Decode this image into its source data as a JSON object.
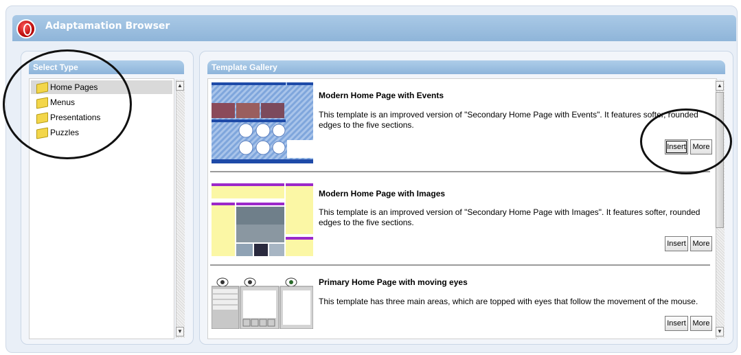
{
  "app": {
    "title": "Adaptamation Browser"
  },
  "left_panel": {
    "header": "Select Type",
    "items": [
      {
        "label": "Home Pages",
        "icon": "folder-icon",
        "selected": true
      },
      {
        "label": "Menus",
        "icon": "folder-icon",
        "selected": false
      },
      {
        "label": "Presentations",
        "icon": "folder-icon",
        "selected": false
      },
      {
        "label": "Puzzles",
        "icon": "folder-icon",
        "selected": false
      }
    ]
  },
  "right_panel": {
    "header": "Template Gallery",
    "templates": [
      {
        "title": "Modern Home Page with Events",
        "description": "This template is an improved version of \"Secondary Home Page with Events\". It features softer, rounded edges to the five sections.",
        "insert_label": "Insert",
        "more_label": "More"
      },
      {
        "title": "Modern Home Page with Images",
        "description": "This template is an improved version of \"Secondary Home Page with Images\". It features softer, rounded edges to the five sections.",
        "insert_label": "Insert",
        "more_label": "More"
      },
      {
        "title": "Primary Home Page with moving eyes",
        "description": "This template has three main areas, which are topped with eyes that follow the movement of the mouse.",
        "insert_label": "Insert",
        "more_label": "More"
      }
    ]
  },
  "colors": {
    "title_bar": "#8fb5d9",
    "panel_header": "#8db4da",
    "selected_row": "#d9d9d9",
    "folder": "#f3d64a"
  }
}
